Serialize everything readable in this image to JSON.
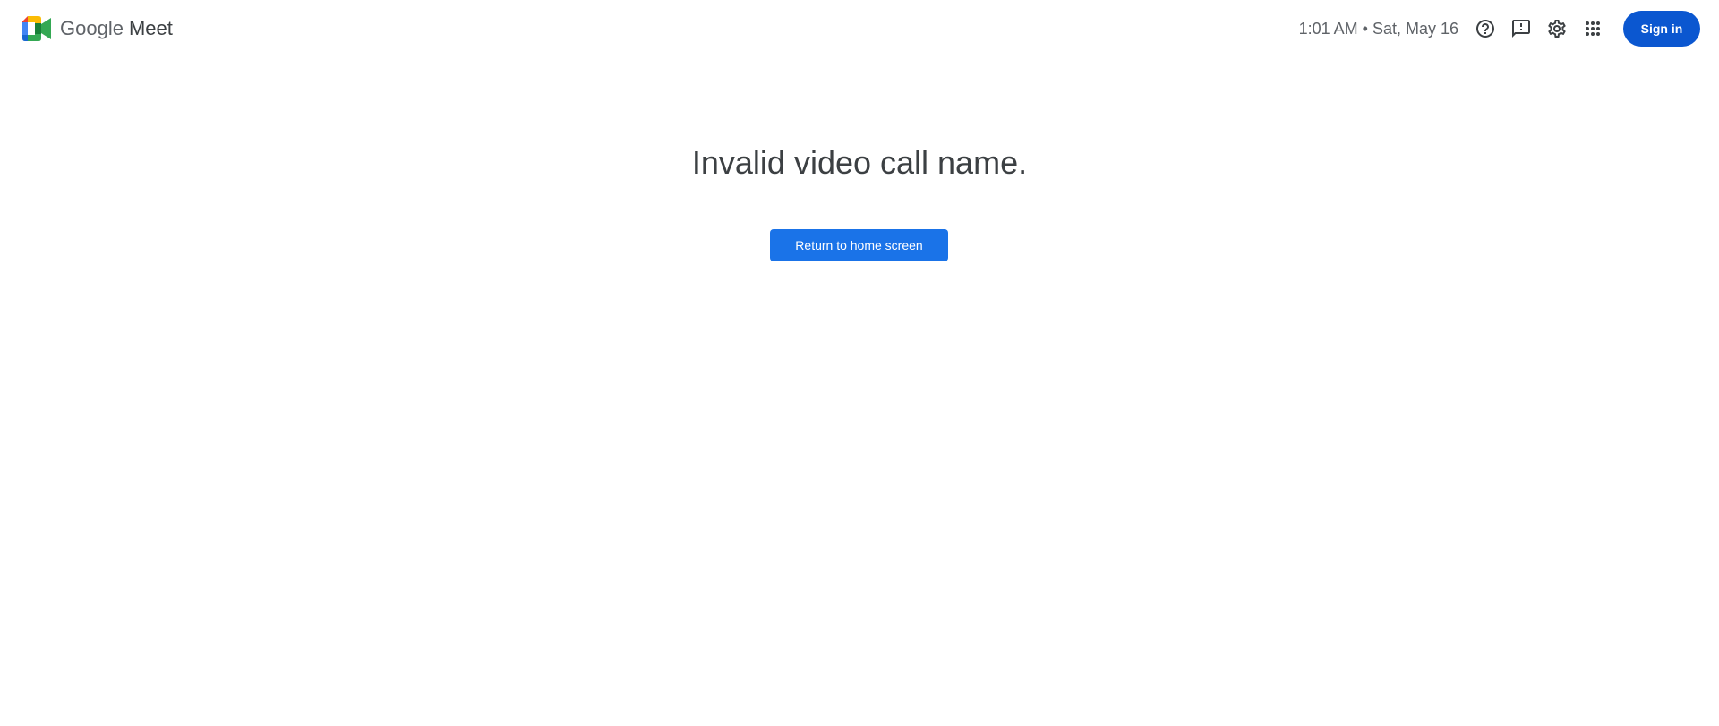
{
  "brand": {
    "logo_icon": "google-meet-icon",
    "google": "Google",
    "meet": "Meet"
  },
  "header": {
    "datetime": "1:01 AM • Sat, May 16",
    "help_icon": "help-icon",
    "feedback_icon": "feedback-icon",
    "settings_icon": "settings-icon",
    "apps_icon": "apps-grid-icon",
    "sign_in": "Sign in"
  },
  "main": {
    "message": "Invalid video call name.",
    "return_button": "Return to home screen"
  },
  "colors": {
    "primary_blue": "#1a73e8",
    "signin_blue": "#0b57d0",
    "text_dark": "#3c4043",
    "text_muted": "#5f6368",
    "meet_yellow": "#fbbc04",
    "meet_red": "#ea4335",
    "meet_blue": "#4285f4",
    "meet_green": "#34a853",
    "meet_dark_green": "#188038"
  }
}
